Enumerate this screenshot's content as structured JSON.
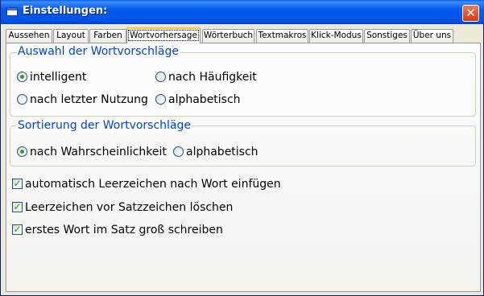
{
  "window": {
    "title": "Einstellungen:",
    "close_glyph": "✕"
  },
  "tabs": [
    {
      "label": "Aussehen"
    },
    {
      "label": "Layout"
    },
    {
      "label": "Farben"
    },
    {
      "label": "Wortvorhersage",
      "active": true
    },
    {
      "label": "Wörterbuch"
    },
    {
      "label": "Textmakros"
    },
    {
      "label": "Klick-Modus"
    },
    {
      "label": "Sonstiges"
    },
    {
      "label": "Über uns"
    }
  ],
  "selection_group": {
    "title": "Auswahl der Wortvorschläge",
    "options": [
      {
        "label": "intelligent",
        "checked": true
      },
      {
        "label": "nach Häufigkeit",
        "checked": false
      },
      {
        "label": "nach letzter Nutzung",
        "checked": false
      },
      {
        "label": "alphabetisch",
        "checked": false
      }
    ]
  },
  "sort_group": {
    "title": "Sortierung der Wortvorschläge",
    "options": [
      {
        "label": "nach Wahrscheinlichkeit",
        "checked": true
      },
      {
        "label": "alphabetisch",
        "checked": false
      }
    ]
  },
  "checkboxes": [
    {
      "label": "automatisch Leerzeichen nach Wort einfügen",
      "checked": true
    },
    {
      "label": "Leerzeichen vor Satzzeichen löschen",
      "checked": true
    },
    {
      "label": "erstes Wort im Satz groß schreiben",
      "checked": true
    }
  ],
  "check_glyph": "✓"
}
